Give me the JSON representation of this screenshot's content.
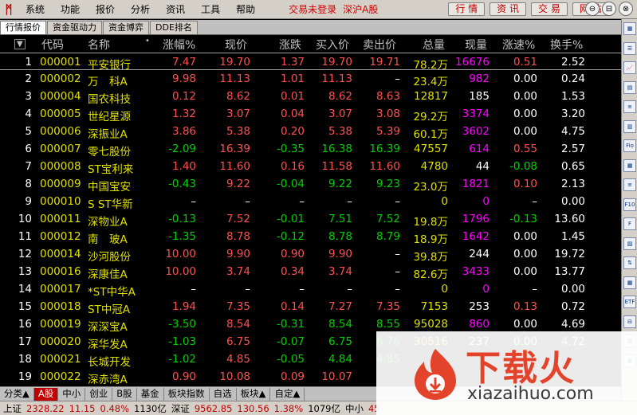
{
  "menubar": {
    "logo": "ᛗ",
    "items": [
      "系统",
      "功能",
      "报价",
      "分析",
      "资讯",
      "工具",
      "帮助"
    ],
    "status": "交易未登录",
    "market": "深沪A股",
    "buttons": [
      "行 情",
      "资 讯",
      "交 易",
      "网 站"
    ],
    "window_buttons": [
      "⊖",
      "⊟",
      "⊗"
    ]
  },
  "tabs": [
    {
      "label": "行情报价",
      "active": true
    },
    {
      "label": "资金驱动力",
      "active": false
    },
    {
      "label": "资金博弈",
      "active": false
    },
    {
      "label": "DDE排名",
      "active": false
    }
  ],
  "columns": {
    "sort": "▼",
    "code": "代码",
    "name": "名称",
    "dot": "•",
    "pct": "涨幅%",
    "price": "现价",
    "change": "涨跌",
    "bid": "买入价",
    "ask": "卖出价",
    "volume": "总量",
    "cur_vol": "现量",
    "speed": "涨速%",
    "turnover": "换手%"
  },
  "rows": [
    {
      "no": "1",
      "code": "000001",
      "name": "平安银行",
      "pct": "7.47",
      "price": "19.70",
      "change": "1.37",
      "bid": "19.70",
      "ask": "19.71",
      "volume": "78.2万",
      "cur_vol": "16676",
      "speed": "0.51",
      "turnover": "2.52",
      "dir": "up",
      "cvc": "mg",
      "spd": "up"
    },
    {
      "no": "2",
      "code": "000002",
      "name": "万　科A",
      "pct": "9.98",
      "price": "11.13",
      "change": "1.01",
      "bid": "11.13",
      "ask": "–",
      "volume": "23.4万",
      "cur_vol": "982",
      "speed": "0.00",
      "turnover": "0.24",
      "dir": "up",
      "cvc": "mg",
      "spd": "wt"
    },
    {
      "no": "3",
      "code": "000004",
      "name": "国农科技",
      "pct": "0.12",
      "price": "8.62",
      "change": "0.01",
      "bid": "8.62",
      "ask": "8.63",
      "volume": "12817",
      "cur_vol": "185",
      "speed": "0.00",
      "turnover": "1.53",
      "dir": "up",
      "cvc": "wt",
      "spd": "wt"
    },
    {
      "no": "4",
      "code": "000005",
      "name": "世纪星源",
      "pct": "1.32",
      "price": "3.07",
      "change": "0.04",
      "bid": "3.07",
      "ask": "3.08",
      "volume": "29.2万",
      "cur_vol": "3374",
      "speed": "0.00",
      "turnover": "3.20",
      "dir": "up",
      "cvc": "mg",
      "spd": "wt"
    },
    {
      "no": "5",
      "code": "000006",
      "name": "深振业A",
      "pct": "3.86",
      "price": "5.38",
      "change": "0.20",
      "bid": "5.38",
      "ask": "5.39",
      "volume": "60.1万",
      "cur_vol": "3602",
      "speed": "0.00",
      "turnover": "4.75",
      "dir": "up",
      "cvc": "mg",
      "spd": "wt"
    },
    {
      "no": "6",
      "code": "000007",
      "name": "零七股份",
      "pct": "-2.09",
      "price": "16.39",
      "change": "-0.35",
      "bid": "16.38",
      "ask": "16.39",
      "volume": "47557",
      "cur_vol": "614",
      "speed": "0.55",
      "turnover": "2.57",
      "dir": "dn",
      "cvc": "mg",
      "spd": "up"
    },
    {
      "no": "7",
      "code": "000008",
      "name": "ST宝利来",
      "pct": "1.40",
      "price": "11.60",
      "change": "0.16",
      "bid": "11.58",
      "ask": "11.60",
      "volume": "4780",
      "cur_vol": "44",
      "speed": "-0.08",
      "turnover": "0.65",
      "dir": "up",
      "cvc": "wt",
      "spd": "dn"
    },
    {
      "no": "8",
      "code": "000009",
      "name": "中国宝安",
      "pct": "-0.43",
      "price": "9.22",
      "change": "-0.04",
      "bid": "9.22",
      "ask": "9.23",
      "volume": "23.0万",
      "cur_vol": "1821",
      "speed": "0.10",
      "turnover": "2.13",
      "dir": "dn",
      "cvc": "mg",
      "spd": "up"
    },
    {
      "no": "9",
      "code": "000010",
      "name": "S ST华新",
      "pct": "–",
      "price": "–",
      "change": "–",
      "bid": "–",
      "ask": "–",
      "volume": "0",
      "cur_vol": "0",
      "speed": "–",
      "turnover": "0.00",
      "dir": "wt",
      "cvc": "mg",
      "spd": "wt"
    },
    {
      "no": "10",
      "code": "000011",
      "name": "深物业A",
      "pct": "-0.13",
      "price": "7.52",
      "change": "-0.01",
      "bid": "7.51",
      "ask": "7.52",
      "volume": "19.8万",
      "cur_vol": "1796",
      "speed": "-0.13",
      "turnover": "13.60",
      "dir": "dn",
      "cvc": "mg",
      "spd": "dn"
    },
    {
      "no": "11",
      "code": "000012",
      "name": "南　玻A",
      "pct": "-1.35",
      "price": "8.78",
      "change": "-0.12",
      "bid": "8.78",
      "ask": "8.79",
      "volume": "18.9万",
      "cur_vol": "1642",
      "speed": "0.00",
      "turnover": "1.45",
      "dir": "dn",
      "cvc": "mg",
      "spd": "wt"
    },
    {
      "no": "12",
      "code": "000014",
      "name": "沙河股份",
      "pct": "10.00",
      "price": "9.90",
      "change": "0.90",
      "bid": "9.90",
      "ask": "–",
      "volume": "39.8万",
      "cur_vol": "244",
      "speed": "0.00",
      "turnover": "19.72",
      "dir": "up",
      "cvc": "wt",
      "spd": "wt"
    },
    {
      "no": "13",
      "code": "000016",
      "name": "深康佳A",
      "pct": "10.00",
      "price": "3.74",
      "change": "0.34",
      "bid": "3.74",
      "ask": "–",
      "volume": "82.6万",
      "cur_vol": "3433",
      "speed": "0.00",
      "turnover": "13.77",
      "dir": "up",
      "cvc": "mg",
      "spd": "wt"
    },
    {
      "no": "14",
      "code": "000017",
      "name": "*ST中华A",
      "pct": "–",
      "price": "–",
      "change": "–",
      "bid": "–",
      "ask": "–",
      "volume": "0",
      "cur_vol": "0",
      "speed": "–",
      "turnover": "0.00",
      "dir": "wt",
      "cvc": "mg",
      "spd": "wt"
    },
    {
      "no": "15",
      "code": "000018",
      "name": "ST中冠A",
      "pct": "1.94",
      "price": "7.35",
      "change": "0.14",
      "bid": "7.27",
      "ask": "7.35",
      "volume": "7153",
      "cur_vol": "253",
      "speed": "0.13",
      "turnover": "0.72",
      "dir": "up",
      "cvc": "wt",
      "spd": "up"
    },
    {
      "no": "16",
      "code": "000019",
      "name": "深深宝A",
      "pct": "-3.50",
      "price": "8.54",
      "change": "-0.31",
      "bid": "8.54",
      "ask": "8.55",
      "volume": "95028",
      "cur_vol": "860",
      "speed": "0.00",
      "turnover": "4.69",
      "dir": "dn",
      "cvc": "mg",
      "spd": "wt"
    },
    {
      "no": "17",
      "code": "000020",
      "name": "深华发A",
      "pct": "-1.03",
      "price": "6.75",
      "change": "-0.07",
      "bid": "6.75",
      "ask": "6.76",
      "volume": "30516",
      "cur_vol": "237",
      "speed": "0.00",
      "turnover": "4.72",
      "dir": "dn",
      "cvc": "wt",
      "spd": "wt"
    },
    {
      "no": "18",
      "code": "000021",
      "name": "长城开发",
      "pct": "-1.02",
      "price": "4.85",
      "change": "-0.05",
      "bid": "4.84",
      "ask": "4.85",
      "volume": "",
      "cur_vol": "",
      "speed": "",
      "turnover": "",
      "dir": "dn",
      "cvc": "wt",
      "spd": "wt"
    },
    {
      "no": "19",
      "code": "000022",
      "name": "深赤湾A",
      "pct": "0.90",
      "price": "10.08",
      "change": "0.09",
      "bid": "10.07",
      "ask": "",
      "volume": "",
      "cur_vol": "",
      "speed": "",
      "turnover": "",
      "dir": "up",
      "cvc": "wt",
      "spd": "wt"
    }
  ],
  "bottom_tabs": [
    {
      "label": "分类▲",
      "active": false
    },
    {
      "label": "A股",
      "active": true
    },
    {
      "label": "中小",
      "active": false
    },
    {
      "label": "创业",
      "active": false
    },
    {
      "label": "B股",
      "active": false
    },
    {
      "label": "基金",
      "active": false
    },
    {
      "label": "板块指数",
      "active": false
    },
    {
      "label": "自选",
      "active": false
    },
    {
      "label": "板块▲",
      "active": false
    },
    {
      "label": "自定▲",
      "active": false
    }
  ],
  "index_bar": {
    "sh_label": "上证",
    "sh_value": "2328.22",
    "sh_change": "11.15",
    "sh_pct": "0.48%",
    "sh_amount": "1130亿",
    "sz_label": "深证",
    "sz_value": "9562.85",
    "sz_change": "130.56",
    "sz_pct": "1.38%",
    "sz_amount": "1079亿",
    "sme_label": "中小",
    "sme_value": "45"
  },
  "right_toolbar": [
    "▦",
    "☰",
    "📈",
    "▤",
    "≡",
    "▥",
    "Fio",
    "▦",
    "≡",
    "F10",
    "F",
    "▨",
    "⇅",
    "▦",
    "ETF",
    "⊟",
    "▦",
    "▣"
  ],
  "watermark": {
    "title": "下载火",
    "url": "xiazaihuo.com",
    "colors": {
      "accent": "#e3432b",
      "url": "#3a3a3a"
    }
  },
  "colors": {
    "up": "#ff5050",
    "down": "#00d000",
    "code": "#e0e000",
    "volume": "#e0e000",
    "cur_vol_hot": "#ff00ff",
    "background": "#000000"
  }
}
